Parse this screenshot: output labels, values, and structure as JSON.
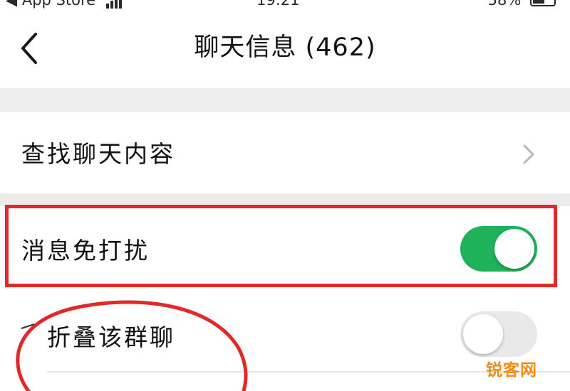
{
  "status_bar": {
    "carrier": "◀ App Store",
    "time": "19:21",
    "battery": "58%"
  },
  "nav": {
    "title": "聊天信息 (462)",
    "back_icon": "chevron-left-icon"
  },
  "rows": [
    {
      "label": "查找聊天内容",
      "type": "link",
      "icon": "chevron-right-icon"
    },
    {
      "label": "消息免打扰",
      "type": "toggle",
      "on": true
    },
    {
      "label": "折叠该群聊",
      "type": "toggle",
      "on": false
    }
  ],
  "annotations": {
    "highlight_color": "#e02a2a"
  },
  "watermark": "锐客网",
  "colors": {
    "toggle_on": "#1fb25a",
    "toggle_off": "#e9e9ea",
    "section_gap": "#ededed",
    "watermark": "#f28c18"
  }
}
